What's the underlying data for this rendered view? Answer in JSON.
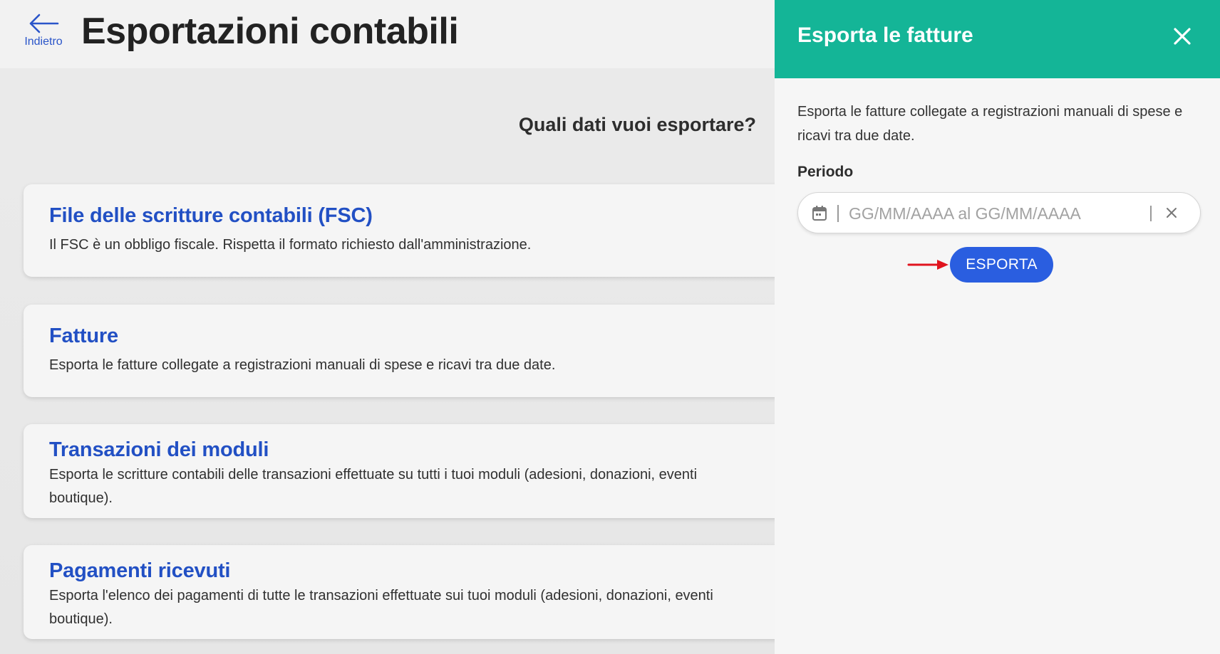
{
  "header": {
    "back_label": "Indietro",
    "title": "Esportazioni contabili"
  },
  "main": {
    "question": "Quali dati vuoi esportare?",
    "cards": [
      {
        "title": "File delle scritture contabili (FSC)",
        "description": "Il FSC è un obbligo fiscale. Rispetta il formato richiesto dall'amministrazione."
      },
      {
        "title": "Fatture",
        "description": "Esporta le fatture collegate a registrazioni manuali di spese e ricavi tra due date."
      },
      {
        "title": "Transazioni dei moduli",
        "description": "Esporta le scritture contabili delle transazioni effettuate su tutti i tuoi moduli (adesioni, donazioni, eventi boutique)."
      },
      {
        "title": "Pagamenti ricevuti",
        "description": "Esporta l'elenco dei pagamenti di tutte le transazioni effettuate sui tuoi moduli (adesioni, donazioni, eventi boutique)."
      }
    ]
  },
  "panel": {
    "title": "Esporta le fatture",
    "description": "Esporta le fatture collegate a registrazioni manuali di spese e ricavi tra due date.",
    "period_label": "Periodo",
    "date_field": {
      "value": "",
      "placeholder": "GG/MM/AAAA al GG/MM/AAAA"
    },
    "export_label": "ESPORTA"
  },
  "icons": {
    "back": "arrow-left-icon",
    "close": "close-icon",
    "calendar": "calendar-icon",
    "clear": "clear-icon",
    "annotation": "red-arrow-icon"
  },
  "colors": {
    "accent_blue": "#2250c4",
    "panel_header": "#14b597",
    "button_blue": "#2a5ee0",
    "annotation_red": "#e0141e"
  }
}
